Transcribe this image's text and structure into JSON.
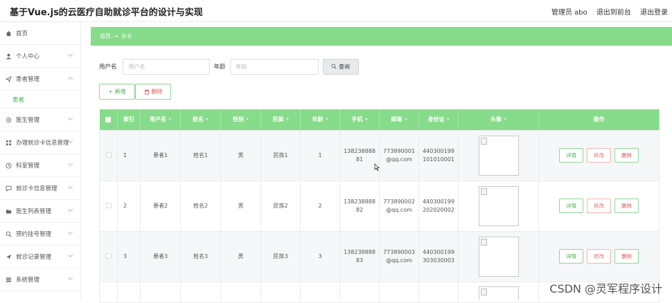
{
  "header": {
    "title": "基于Vue.js的云医疗自助就诊平台的设计与实现",
    "admin": "管理员 abo",
    "back_front": "退出到前台",
    "logout": "退出登录"
  },
  "sidebar": {
    "items": [
      {
        "label": "首页",
        "icon": "home-icon",
        "chevron": false
      },
      {
        "label": "个人中心",
        "icon": "user-icon",
        "chevron": true
      },
      {
        "label": "患者管理",
        "icon": "send-icon",
        "chevron": true,
        "open": true
      },
      {
        "label": "医生管理",
        "icon": "settings-icon",
        "chevron": true
      },
      {
        "label": "办理就诊卡信息管理",
        "icon": "grid-icon",
        "chevron": true
      },
      {
        "label": "科室管理",
        "icon": "clock-icon",
        "chevron": true
      },
      {
        "label": "就诊卡信息管理",
        "icon": "message-icon",
        "chevron": true
      },
      {
        "label": "医生列表管理",
        "icon": "folder-icon",
        "chevron": true
      },
      {
        "label": "预约挂号管理",
        "icon": "search-icon",
        "chevron": true
      },
      {
        "label": "就诊记录管理",
        "icon": "send-icon",
        "chevron": true
      },
      {
        "label": "系统管理",
        "icon": "menu-icon",
        "chevron": true
      }
    ],
    "sub_item": "患者"
  },
  "breadcrumb": {
    "home": "首页",
    "arrow": "→",
    "current": "患者"
  },
  "search": {
    "username_label": "用户名",
    "username_placeholder": "用户名",
    "age_label": "年龄",
    "age_placeholder": "年龄",
    "query": "查询"
  },
  "actions": {
    "add": "+ 新增",
    "delete": "删除"
  },
  "table": {
    "columns": [
      "索引",
      "用户名",
      "姓名",
      "性别",
      "民族",
      "年龄",
      "手机",
      "邮箱",
      "身份证",
      "头像",
      "操作"
    ],
    "rows": [
      {
        "index": "1",
        "username": "患者1",
        "name": "姓名1",
        "gender": "男",
        "ethnic": "民族1",
        "age": "1",
        "phone_a": "138238888",
        "phone_b": "81",
        "email_a": "773890001",
        "email_b": "@qq.com",
        "id_a": "440300199",
        "id_b": "101010001"
      },
      {
        "index": "2",
        "username": "患者2",
        "name": "姓名2",
        "gender": "男",
        "ethnic": "民族2",
        "age": "2",
        "phone_a": "138238888",
        "phone_b": "82",
        "email_a": "773890002",
        "email_b": "@qq.com",
        "id_a": "440300199",
        "id_b": "202020002"
      },
      {
        "index": "3",
        "username": "患者3",
        "name": "姓名3",
        "gender": "男",
        "ethnic": "民族3",
        "age": "3",
        "phone_a": "138238888",
        "phone_b": "83",
        "email_a": "773890003",
        "email_b": "@qq.com",
        "id_a": "440300199",
        "id_b": "303030003"
      }
    ],
    "ops": {
      "detail": "详情",
      "edit": "修改",
      "remove": "删除"
    }
  },
  "watermark": "CSDN @灵军程序设计"
}
